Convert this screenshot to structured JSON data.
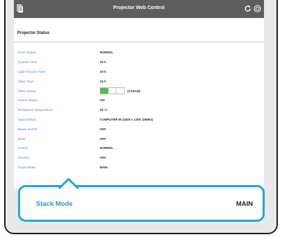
{
  "app": {
    "title": "Projector Web Control"
  },
  "section": {
    "title": "Projector Status"
  },
  "rows": [
    {
      "label": "Error Status",
      "value": "NORMAL"
    },
    {
      "label": "System Time",
      "value": "10 h"
    },
    {
      "label": "Light Source Time",
      "value": "10 h"
    },
    {
      "label": "Filter Time",
      "value": "10 h"
    },
    {
      "label": "Filter Status",
      "value": "(CLEAN)",
      "level_segments_filled": 1,
      "level_segments_total": 3
    },
    {
      "label": "Power Status",
      "value": "ON"
    },
    {
      "label": "Peripheral Temperature",
      "value": "25 °C"
    },
    {
      "label": "Input Status",
      "value": "COMPUTER IN  (1920 x 1200 @60Hz)"
    },
    {
      "label": "Blank On/Off",
      "value": "OFF"
    },
    {
      "label": "Mute",
      "value": "OFF"
    },
    {
      "label": "Freeze",
      "value": "NORMAL"
    },
    {
      "label": "Shutter",
      "value": "OFF"
    },
    {
      "label": "Stack Mode",
      "value": "MAIN"
    }
  ],
  "callout": {
    "label": "Stack Mode",
    "value": "MAIN"
  },
  "icons": {
    "menu": "document-menu-icon",
    "refresh": "refresh-icon",
    "settings": "settings-icon"
  },
  "colors": {
    "topbar": "#5d5d5d",
    "label": "#7fa7d9",
    "accent": "#23a6da",
    "filter_ok": "#4dbb49"
  }
}
